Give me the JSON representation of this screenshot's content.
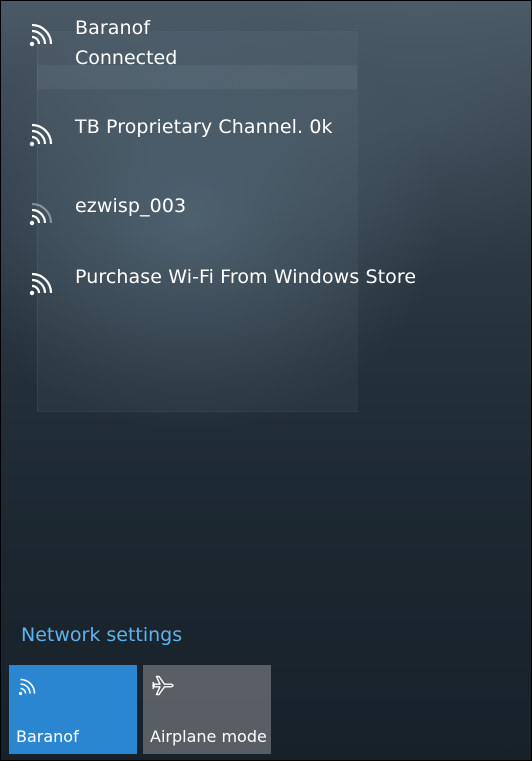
{
  "networks": [
    {
      "name": "Baranof",
      "status": "Connected",
      "icon": "wifi-icon",
      "signal": 4
    },
    {
      "name": "TB Proprietary Channel. 0k",
      "icon": "wifi-icon",
      "signal": 4
    },
    {
      "name": "ezwisp_003",
      "icon": "wifi-icon",
      "signal": 2
    },
    {
      "name": "Purchase Wi-Fi From Windows Store",
      "icon": "wifi-icon",
      "signal": 4
    }
  ],
  "network_settings_label": "Network settings",
  "tiles": {
    "wifi": {
      "label": "Baranof",
      "icon": "wifi-icon",
      "active": true
    },
    "airplane": {
      "label": "Airplane mode",
      "icon": "airplane-icon",
      "active": false
    }
  },
  "colors": {
    "accent": "#2b86d1",
    "link": "#5fb2f0",
    "tile_inactive": "#5f646a"
  }
}
